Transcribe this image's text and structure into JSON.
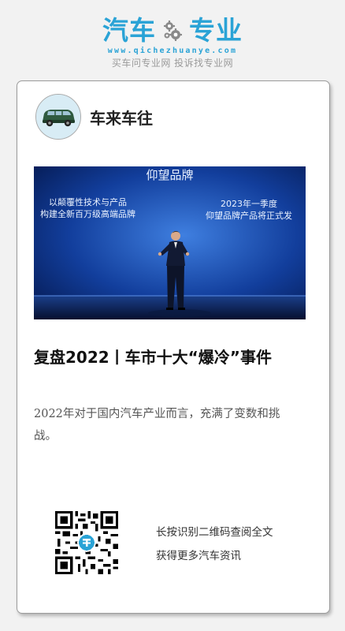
{
  "brand": {
    "name_left": "汽车",
    "name_right": "专业",
    "url": "www.qichezhuanye.com",
    "slogan": "买车问专业网 投诉找专业网",
    "color": "#2aa3d6"
  },
  "post": {
    "author": "车来车往",
    "avatar_icon": "car-avatar-icon",
    "hero": {
      "title": "仰望品牌",
      "left_line1": "以颠覆性技术与产品",
      "left_line2": "构建全新百万级高端品牌",
      "right_line1": "2023年一季度",
      "right_line2": "仰望品牌产品将正式发"
    },
    "headline": "复盘2022丨车市十大“爆冷”事件",
    "summary": "2022年对于国内汽车产业而言，充满了变数和挑战。"
  },
  "footer": {
    "qr_icon": "qr-code-icon",
    "cta_line1": "长按识别二维码查阅全文",
    "cta_line2": "获得更多汽车资讯"
  }
}
